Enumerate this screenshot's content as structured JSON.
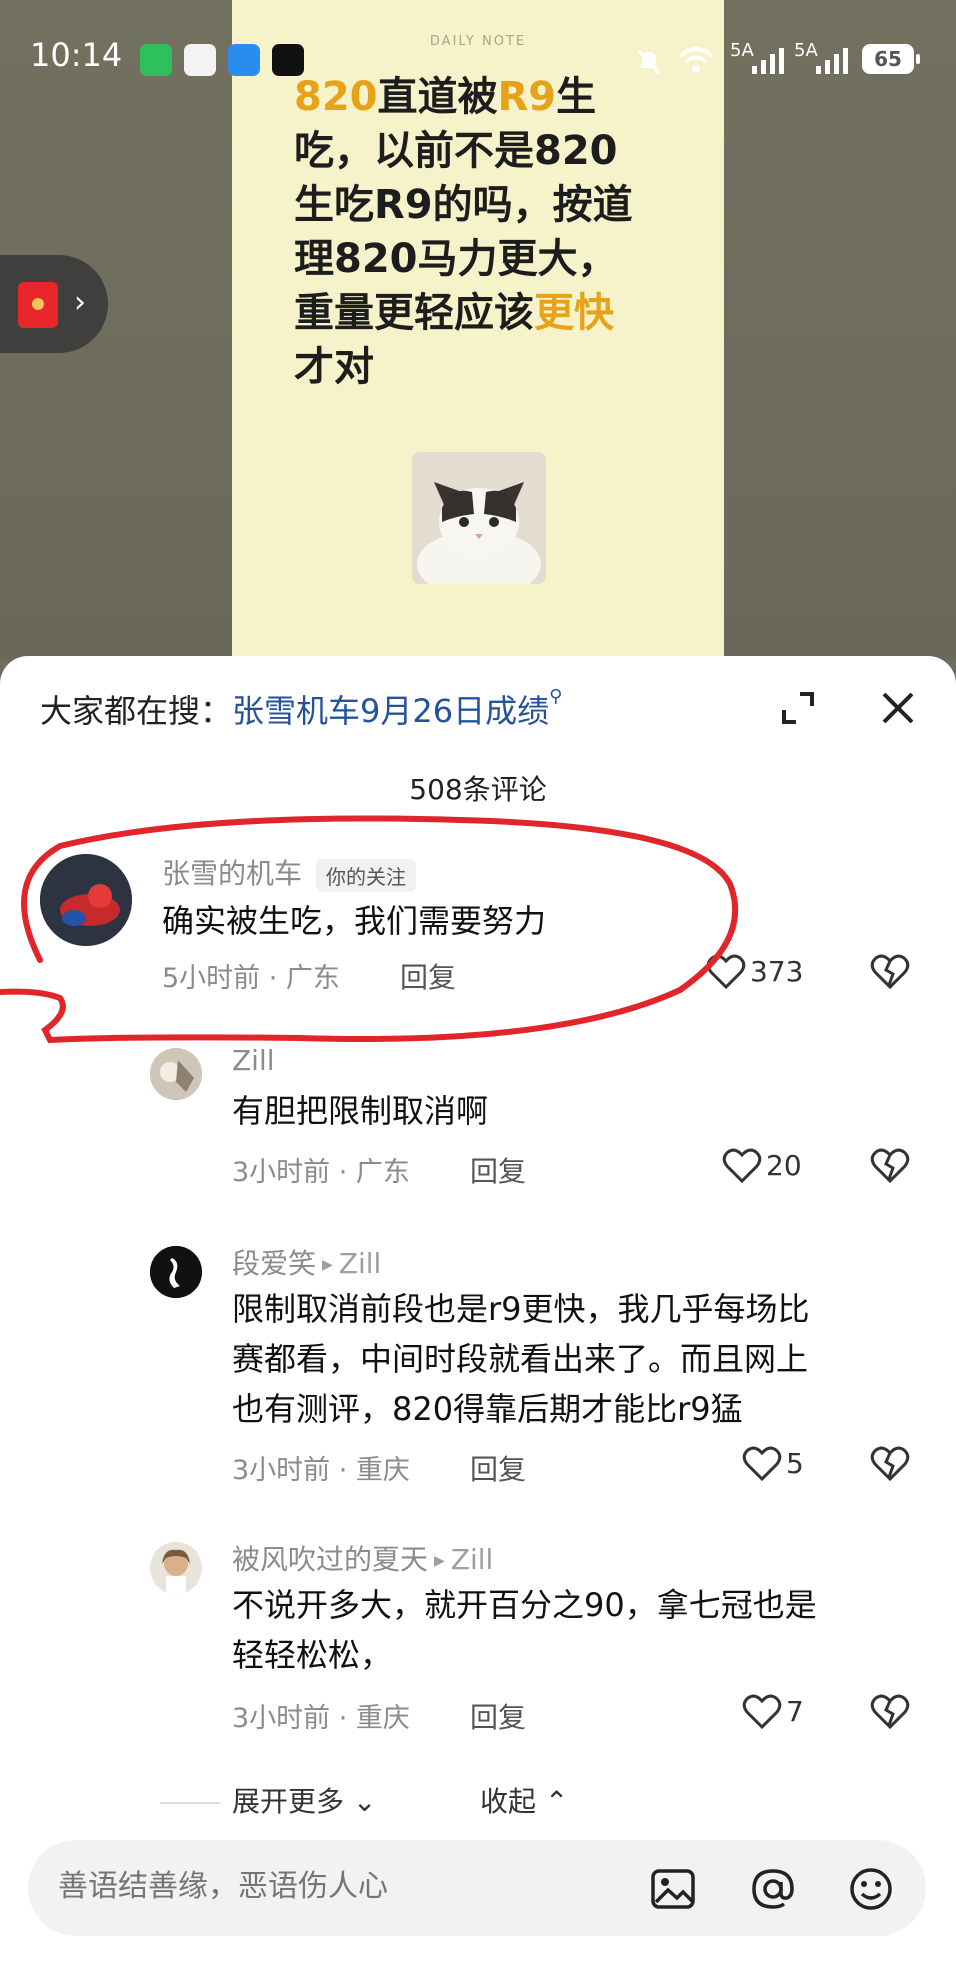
{
  "status_bar": {
    "time": "10:14",
    "signal_1": "5A",
    "signal_2": "5A",
    "battery": "65"
  },
  "note": {
    "brand": "DAILY NOTE",
    "line1_a": "820",
    "line1_b": "直道被",
    "line1_c": "R9",
    "line1_d": "生",
    "line2": "吃，以前不是820",
    "line3": "生吃R9的吗，按道",
    "line4": "理820马力更大，",
    "line5_a": "重量更轻应该",
    "line5_b": "更快",
    "line6": "才对"
  },
  "sheet": {
    "search_label": "大家都在搜：",
    "search_term": "张雪机车9月26日成绩",
    "comment_count": "508条评论"
  },
  "comments": [
    {
      "name": "张雪的机车",
      "badge": "你的关注",
      "text": "确实被生吃，我们需要努力",
      "meta": "5小时前 · 广东",
      "reply": "回复",
      "likes": "373"
    },
    {
      "name": "Zill",
      "text": "有胆把限制取消啊",
      "meta": "3小时前 · 广东",
      "reply": "回复",
      "likes": "20"
    },
    {
      "name": "段爱笑",
      "reply_to": "Zill",
      "text_line1": "限制取消前段也是r9更快，我几乎每场比",
      "text_line2": "赛都看，中间时段就看出来了。而且网上",
      "text_line3": "也有测评，820得靠后期才能比r9猛",
      "meta": "3小时前 · 重庆",
      "reply": "回复",
      "likes": "5"
    },
    {
      "name": "被风吹过的夏天",
      "reply_to": "Zill",
      "text_line1": "不说开多大，就开百分之90，拿七冠也是",
      "text_line2": "轻轻松松，",
      "meta": "3小时前 · 重庆",
      "reply": "回复",
      "likes": "7"
    }
  ],
  "footer": {
    "expand_more": "展开更多",
    "collapse": "收起",
    "input_placeholder": "善语结善缘，恶语伤人心"
  },
  "colors": {
    "highlight": "#e8a21a",
    "link": "#24539c",
    "annotation": "#e0262a"
  }
}
